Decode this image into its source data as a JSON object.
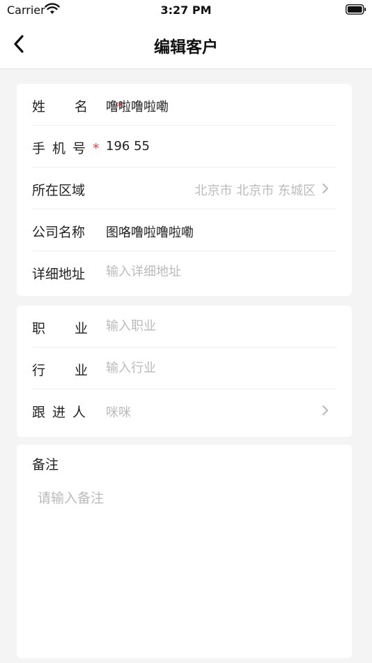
{
  "status_bar": {
    "carrier": "Carrier",
    "time": "3:27 PM"
  },
  "nav": {
    "title": "编辑客户"
  },
  "form": {
    "name": {
      "label": "姓名",
      "required_mark": "*",
      "value": "噜啦噜啦嘞"
    },
    "phone": {
      "label": "手机号",
      "required_mark": "*",
      "value": "196   55"
    },
    "region": {
      "label": "所在区域",
      "value": "北京市 北京市 东城区"
    },
    "company": {
      "label": "公司名称",
      "value": "图咯噜啦噜啦嘞"
    },
    "address": {
      "label": "详细地址",
      "placeholder": "输入详细地址"
    },
    "occupation": {
      "label": "职业",
      "placeholder": "输入职业"
    },
    "industry": {
      "label": "行业",
      "placeholder": "输入行业"
    },
    "follower": {
      "label": "跟进人",
      "placeholder": "咪咪"
    }
  },
  "remark": {
    "label": "备注",
    "placeholder": "请输入备注"
  },
  "colors": {
    "required": "#e43c3c",
    "placeholder": "#bbbbbb",
    "background": "#f4f4f4"
  }
}
